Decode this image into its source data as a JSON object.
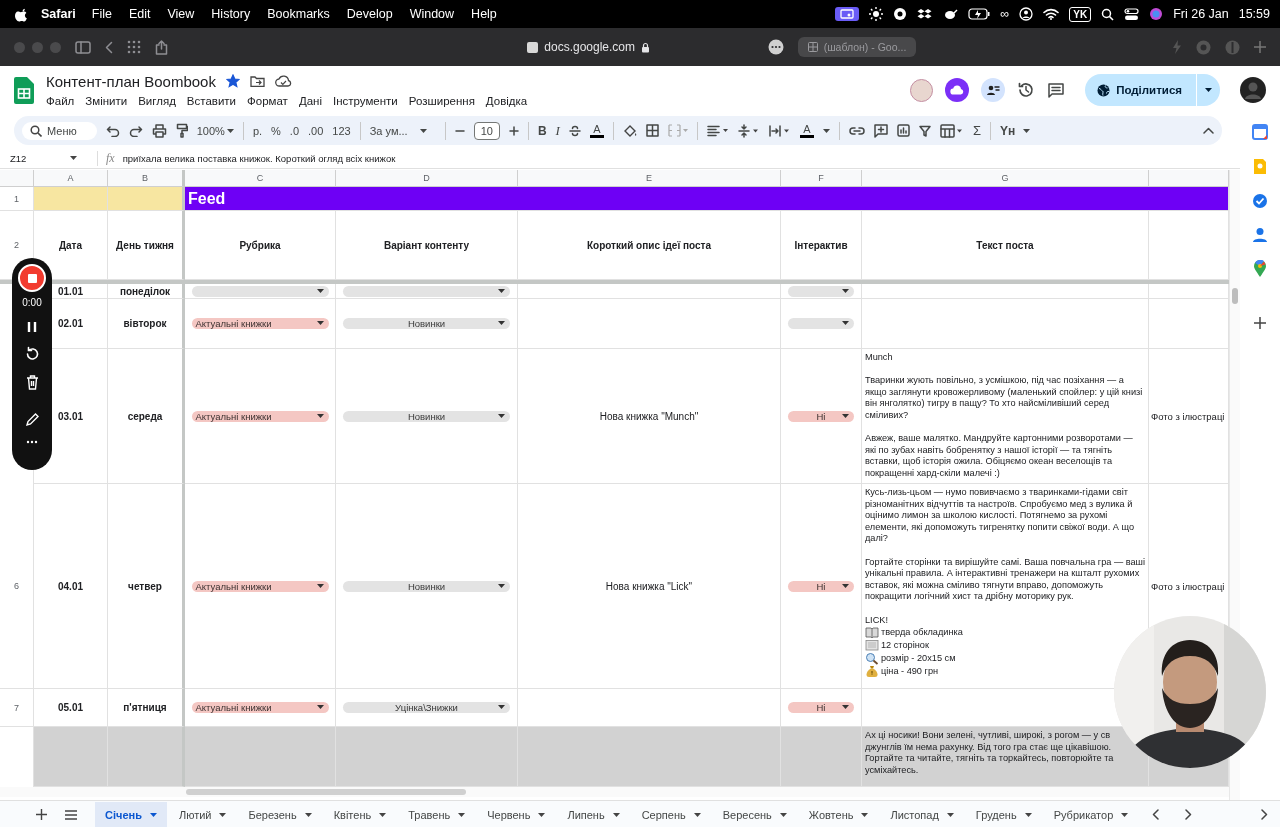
{
  "menubar": {
    "app": "Safari",
    "menus": [
      "File",
      "Edit",
      "View",
      "History",
      "Bookmarks",
      "Develop",
      "Window",
      "Help"
    ],
    "infinity": "∞",
    "keyboard": "YK",
    "date": "Fri 26 Jan",
    "time": "15:59"
  },
  "browser": {
    "url": "docs.google.com",
    "other_tab": "(шаблон) - Goo..."
  },
  "doc": {
    "title": "Контент-план Boombook",
    "starred": true,
    "menus": [
      "Файл",
      "Змінити",
      "Вигляд",
      "Вставити",
      "Формат",
      "Дані",
      "Інструменти",
      "Розширення",
      "Довідка"
    ],
    "share": "Поділитися"
  },
  "toolbar": {
    "search": "Меню",
    "zoom": "100%",
    "currency": "р.",
    "percent": "%",
    "decrease_decimals": ".0",
    "increase_decimals": ".00",
    "more_formats": "123",
    "font": "За ум...",
    "font_size": "10",
    "bold": "B",
    "italic": "I",
    "text_color": "A",
    "rotation": "A",
    "sum": "Σ",
    "input_tools": "Yн"
  },
  "formula_bar": {
    "cell": "Z12",
    "fx": "fx",
    "value": "приїхала велика поставка книжок. Короткий огляд всіх книжок"
  },
  "sheet": {
    "columns": [
      "A",
      "B",
      "C",
      "D",
      "E",
      "F",
      "G"
    ],
    "row_numbers": [
      "1",
      "2"
    ],
    "banner": "Feed",
    "headers": [
      "Дата",
      "День тижня",
      "Рубрика",
      "Варіант контенту",
      "Короткий опис ідеї поста",
      "Інтерактив",
      "Текст поста"
    ],
    "rows": [
      {
        "date": "01.01",
        "day": "понеділок",
        "rubric": {
          "color": "#e3e3e3"
        },
        "variant": {
          "color": "#e3e3e3"
        },
        "interactive": {
          "color": "#e3e3e3"
        },
        "shaded": false
      },
      {
        "date": "02.01",
        "day": "вівторок",
        "rubric": {
          "label": "Актуальні книжки",
          "color": "#f4c7c3"
        },
        "variant": {
          "label": "Новинки",
          "color": "#e3e3e3"
        },
        "interactive": {
          "color": "#e3e3e3"
        },
        "shaded": false
      },
      {
        "date": "03.01",
        "day": "середа",
        "rubric": {
          "label": "Актуальні книжки",
          "color": "#f4c7c3"
        },
        "variant": {
          "label": "Новинки",
          "color": "#e3e3e3"
        },
        "idea": "Нова книжка \"Munch\"",
        "interactive": {
          "label": "Ні",
          "color": "#f4c7c3"
        },
        "post": [
          {
            "text": "Munch"
          },
          {
            "text": "Тваринки жують повільно, з усмішкою, під час позіхання — а якщо заглянути кровожерливому (маленький спойлер: у цій книзі він янголятко) тигру в пащу? То хто найсміливіший серед сміливих?"
          },
          {
            "text": "Авжеж, ваше малятко. Мандруйте картонними розворотами — які по зубах навіть бобренятку з нашої історії — та тягніть вставки, щоб історія ожила. Обіцяємо океан веселощів та покращенні хард-скіли малечі :)"
          }
        ],
        "column_h": "Фото з ілюстраці",
        "shaded": false
      },
      {
        "number": "6",
        "date": "04.01",
        "day": "четвер",
        "rubric": {
          "label": "Актуальні книжки",
          "color": "#f4c7c3"
        },
        "variant": {
          "label": "Новинки",
          "color": "#e3e3e3"
        },
        "idea": "Нова книжка \"Lick\"",
        "interactive": {
          "label": "Ні",
          "color": "#f4c7c3"
        },
        "post": [
          {
            "text": "Кусь-лизь-цьом — нумо повивчаємо з тваринками-гідами світ різноманітних відчуттів та настроїв. Спробуємо мед з вулика й оцінимо лимон за школою кислості. Потягнемо за рухомі елементи, які допоможуть тигренятку попити свіжої води. А що далі?"
          },
          {
            "text": "Гортайте сторінки та вирішуйте самі. Ваша повчальна гра — ваші унікальні правила. А інтерактивні тренажери на кшталт рухомих вставок, які можна сміливо тягнути вправо, допоможуть покращити логічний хист та дрібну моторику рук."
          },
          {
            "text": "LICK!",
            "items": [
              {
                "kind": "book",
                "text": "тверда обкладинка"
              },
              {
                "kind": "pages",
                "text": "12 сторінок"
              },
              {
                "kind": "magnifier",
                "text": "розмір - 20x15 см"
              },
              {
                "kind": "money",
                "text": "ціна - 490 грн"
              }
            ]
          }
        ],
        "column_h": "Фото з ілюстраці",
        "shaded": false
      },
      {
        "number": "7",
        "date": "05.01",
        "day": "п'ятниця",
        "rubric": {
          "label": "Актуальні книжки",
          "color": "#f4c7c3"
        },
        "variant": {
          "label": "Уцінка\\Знижки",
          "color": "#e3e3e3"
        },
        "interactive": {
          "label": "Ні",
          "color": "#f4c7c3"
        },
        "shaded": false
      },
      {
        "post": [
          {
            "text": "Ах ці носики! Вони зелені, чутливі, широкі, з рогом — у св\nджунглів їм нема рахунку. Від того гра стає ще цікавішою.\nГортайте та читайте, тягніть та торкайтесь, повторюйте та\nусміхайтесь."
          }
        ],
        "shaded": true
      }
    ]
  },
  "recorder": {
    "time": "0:00"
  },
  "tabs": [
    {
      "label": "Січень",
      "selected": true
    },
    {
      "label": "Лютий",
      "selected": false
    },
    {
      "label": "Березень",
      "selected": false
    },
    {
      "label": "Квітень",
      "selected": false
    },
    {
      "label": "Травень",
      "selected": false
    },
    {
      "label": "Червень",
      "selected": false
    },
    {
      "label": "Липень",
      "selected": false
    },
    {
      "label": "Серпень",
      "selected": false
    },
    {
      "label": "Вересень",
      "selected": false
    },
    {
      "label": "Жовтень",
      "selected": false
    },
    {
      "label": "Листопад",
      "selected": false
    },
    {
      "label": "Грудень",
      "selected": false
    },
    {
      "label": "Рубрикатор",
      "selected": false
    }
  ]
}
